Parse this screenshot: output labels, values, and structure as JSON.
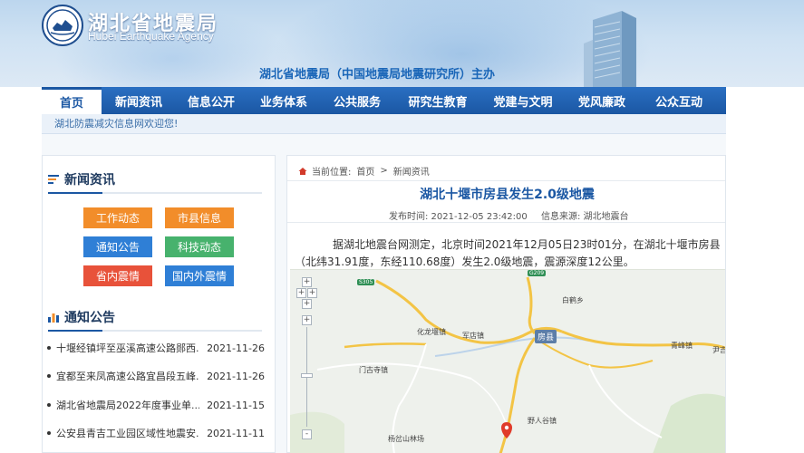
{
  "header": {
    "title": "湖北省地震局",
    "subtitle": "Hubei Earthquake Agency",
    "host": "湖北省地震局（中国地震局地震研究所）主办"
  },
  "nav": {
    "items": [
      {
        "label": "首页"
      },
      {
        "label": "新闻资讯"
      },
      {
        "label": "信息公开"
      },
      {
        "label": "业务体系"
      },
      {
        "label": "公共服务"
      },
      {
        "label": "研究生教育"
      },
      {
        "label": "党建与文明"
      },
      {
        "label": "党风廉政"
      },
      {
        "label": "公众互动"
      }
    ]
  },
  "welcome": "湖北防震减灾信息网欢迎您!",
  "news_section": {
    "title": "新闻资讯",
    "categories": [
      {
        "label": "工作动态",
        "color": "#f28d2a"
      },
      {
        "label": "市县信息",
        "color": "#f28d2a"
      },
      {
        "label": "通知公告",
        "color": "#2f7fd6"
      },
      {
        "label": "科技动态",
        "color": "#47b26d"
      },
      {
        "label": "省内震情",
        "color": "#e8523a"
      },
      {
        "label": "国内外震情",
        "color": "#2f7fd6"
      }
    ]
  },
  "notice_section": {
    "title": "通知公告",
    "items": [
      {
        "title": "十堰经镇坪至巫溪高速公路郧西...",
        "date": "2021-11-26"
      },
      {
        "title": "宜都至来凤高速公路宜昌段五峰...",
        "date": "2021-11-26"
      },
      {
        "title": "湖北省地震局2022年度事业单...",
        "date": "2021-11-15"
      },
      {
        "title": "公安县青吉工业园区域性地震安...",
        "date": "2021-11-11"
      }
    ]
  },
  "breadcrumb": {
    "prefix": "当前位置:",
    "items": [
      "首页",
      "新闻资讯"
    ],
    "separator": ">"
  },
  "article": {
    "title": "湖北十堰市房县发生2.0级地震",
    "publish_time": "发布时间: 2021-12-05 23:42:00",
    "source": "信息来源: 湖北地震台",
    "paragraph": "据湖北地震台网测定，北京时间2021年12月05日23时01分，在湖北十堰市房县（北纬31.91度，东经110.68度）发生2.0级地震，震源深度12公里。"
  },
  "map": {
    "labels": [
      "白鹤乡",
      "化龙堰镇",
      "军店镇",
      "房县",
      "青峰镇",
      "尹吉",
      "门古寺镇",
      "野人谷镇",
      "杨岔山林场"
    ],
    "road_badges": [
      "S305",
      "G209"
    ],
    "zoom_controls": [
      "+",
      "+",
      "+",
      "-"
    ]
  },
  "colors": {
    "brand_blue": "#1b57a3",
    "nav_blue": "#2a6fc2",
    "marker_red": "#e03b2a"
  }
}
